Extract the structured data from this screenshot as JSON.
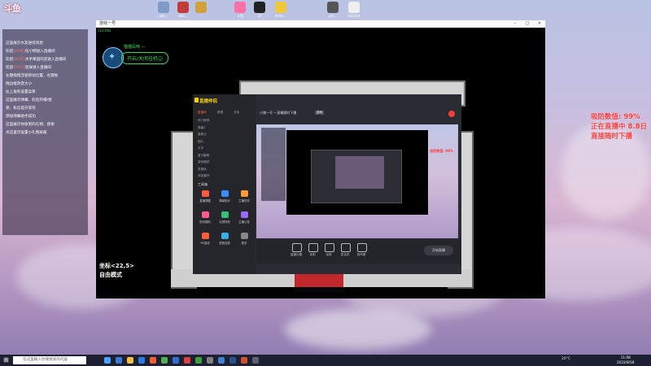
{
  "desktop": {
    "logo": "斗鱼",
    "icons": [
      {
        "label": "a6e...",
        "color": "#7d9ac8"
      },
      {
        "label": "e6a...",
        "color": "#c23a3a"
      },
      {
        "label": "...",
        "color": "#d0a03a"
      },
      {
        "label": "斗鱼",
        "color": "#ff6fa8"
      },
      {
        "label": "22",
        "color": "#222"
      },
      {
        "label": "Arms...",
        "color": "#f0c73a"
      },
      {
        "label": "pic...",
        "color": "#555"
      },
      {
        "label": "test.txt",
        "color": "#eee"
      }
    ]
  },
  "chat": {
    "messages": [
      {
        "pre": "",
        "hi": "",
        "post": "这里展示水友进场消息"
      },
      {
        "pre": "欢迎",
        "hi": "[LV26]",
        "post": "任小明进入直播间"
      },
      {
        "pre": "欢迎",
        "hi": "[LV20]",
        "post": "水手果园的友进入直播间"
      },
      {
        "pre": "欢迎",
        "hi": "[LV15]",
        "post": "星辰进入直播间"
      },
      {
        "pre": "",
        "hi": "",
        "post": "左键拖拽浮窗移动位置，左键拖"
      },
      {
        "pre": "",
        "hi": "",
        "post": "拽边框改变大小"
      },
      {
        "pre": "",
        "hi": "",
        "post": "右上角有设置菜单"
      },
      {
        "pre": "",
        "hi": "",
        "post": "这里展示弹幕、危险开播/接"
      },
      {
        "pre": "",
        "hi": "",
        "post": "受、私信提升等等"
      },
      {
        "pre": "",
        "hi": "",
        "post": "添加弹幕助手成功"
      },
      {
        "pre": "",
        "hi": "",
        "post": "这里展示你收到的礼物、感谢"
      },
      {
        "pre": "",
        "hi": "",
        "post": "点这里可设置小礼物屏蔽"
      }
    ]
  },
  "right_overlay": {
    "lines": [
      "吸防数值: 99%",
      "正在直播中 8.8日",
      "直接随时下播"
    ]
  },
  "game_window": {
    "title": "游戏一号",
    "small_label": "122.0bx",
    "name": "猫猫妈咪 —",
    "pill": "开启/关闭挂机☺",
    "coord": "坐标<22,5>",
    "mode": "自由模式"
  },
  "stream_app": {
    "logo": "直播伴侣",
    "side_tabs": [
      "直播间",
      "数据",
      "互动"
    ],
    "side_items": [
      "热门推荐",
      "屏幕1",
      "摄像头",
      "图片",
      "文字",
      "窗口截取",
      "游戏捕获",
      "多媒体",
      "添加素材"
    ],
    "tools_title": "工具箱",
    "tools": [
      "直播提醒",
      "弹幕助手",
      "主播任务",
      "粉丝福利",
      "礼物特效",
      "主播公告",
      "PK连线",
      "语音连麦",
      "更多"
    ],
    "top_title": "小猪一号 一直播随时下播",
    "top_tag": "游戏",
    "bottom_buttons": [
      "直播设置",
      "录制",
      "话筒",
      "麦克风",
      "扬声器"
    ],
    "start_button": "开始直播"
  },
  "taskbar": {
    "search_placeholder": "在这里输入你要搜索的内容",
    "temperature": "20°C",
    "time": "11:08",
    "date": "2022/8/18"
  }
}
